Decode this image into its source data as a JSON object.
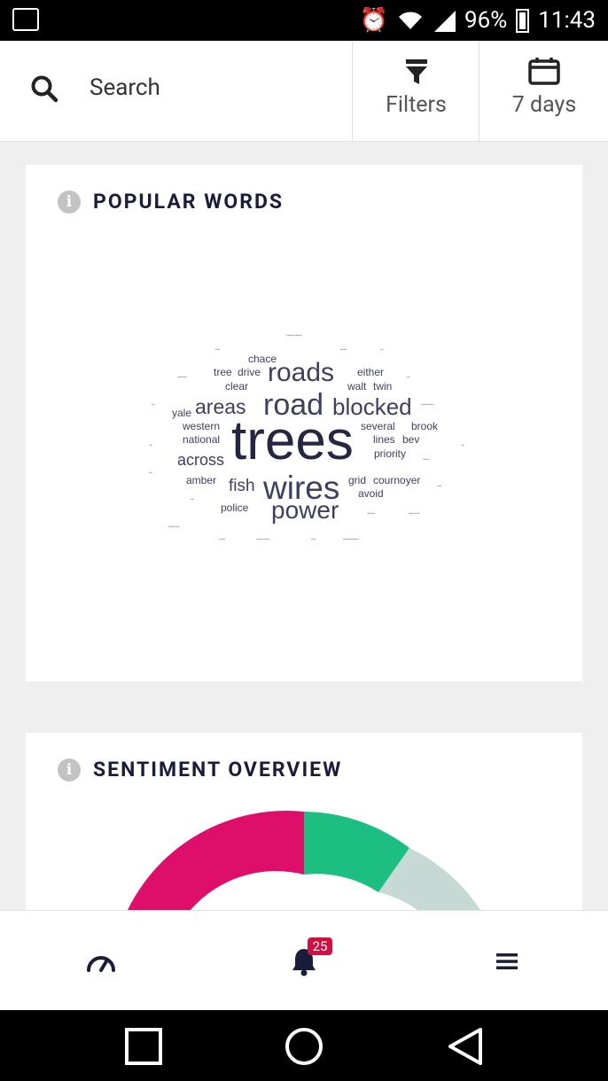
{
  "status_bar": {
    "battery": "96%",
    "time": "11:43"
  },
  "header": {
    "search_placeholder": "Search",
    "filters_label": "Filters",
    "range_label": "7 days"
  },
  "popular_words": {
    "title": "POPULAR WORDS",
    "words": [
      {
        "text": "trees"
      },
      {
        "text": "road"
      },
      {
        "text": "wires"
      },
      {
        "text": "roads"
      },
      {
        "text": "blocked"
      },
      {
        "text": "power"
      },
      {
        "text": "areas"
      },
      {
        "text": "across"
      },
      {
        "text": "fish"
      },
      {
        "text": "chace"
      },
      {
        "text": "tree"
      },
      {
        "text": "drive"
      },
      {
        "text": "clear"
      },
      {
        "text": "either"
      },
      {
        "text": "walt"
      },
      {
        "text": "twin"
      },
      {
        "text": "yale"
      },
      {
        "text": "western"
      },
      {
        "text": "national"
      },
      {
        "text": "several"
      },
      {
        "text": "brook"
      },
      {
        "text": "lines"
      },
      {
        "text": "bev"
      },
      {
        "text": "priority"
      },
      {
        "text": "amber"
      },
      {
        "text": "grid"
      },
      {
        "text": "cournoyer"
      },
      {
        "text": "avoid"
      },
      {
        "text": "police"
      }
    ]
  },
  "sentiment": {
    "title": "SENTIMENT OVERVIEW",
    "colors": {
      "negative": "#de0e6b",
      "positive": "#1cbe82",
      "neutral": "#c7d9d4"
    }
  },
  "bottom_nav": {
    "notification_count": "25"
  }
}
